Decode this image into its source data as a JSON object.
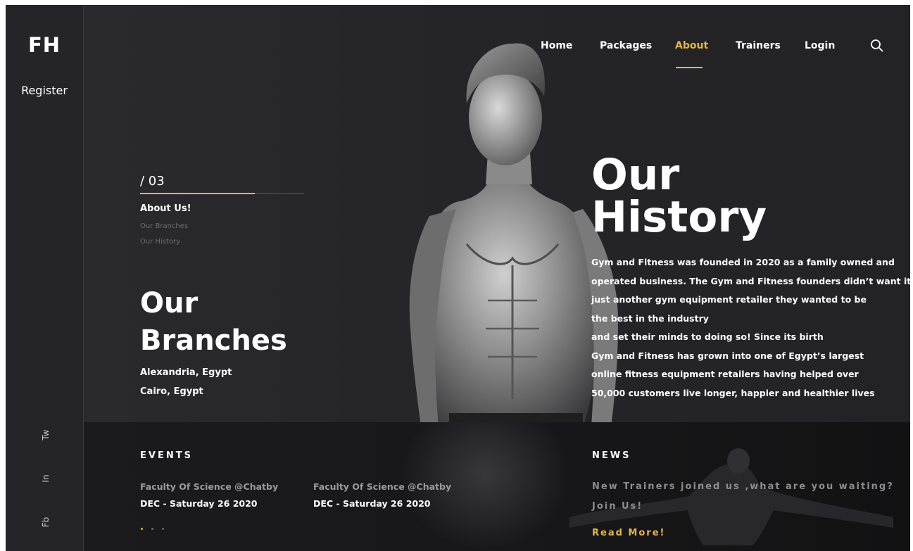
{
  "brand": {
    "logo": "FH",
    "register_label": "Register"
  },
  "social": [
    {
      "label": "Tw",
      "icon": "twitter"
    },
    {
      "label": "In",
      "icon": "linkedin"
    },
    {
      "label": "Fb",
      "icon": "facebook"
    }
  ],
  "nav": {
    "items": [
      "Home",
      "Packages",
      "About",
      "Trainers",
      "Login"
    ],
    "active": "About",
    "search_icon": "search-icon"
  },
  "left": {
    "counter": "/ 03",
    "progress": 0.7,
    "about_title": "About Us!",
    "sub_links": [
      "Our Branches",
      "Our History"
    ],
    "branches_title": "Our\nBranches",
    "branches": [
      "Alexandria, Egypt",
      "Cairo, Egypt"
    ]
  },
  "history": {
    "title": "Our\nHistory",
    "lines": [
      "Gym and Fitness was founded in 2020 as a family owned and",
      "operated business. The Gym and Fitness founders didn’t want it to be",
      "just another gym equipment retailer they wanted to be",
      "the best in the industry",
      "and set their minds to doing so! Since its birth",
      "Gym and Fitness has grown into one of Egypt’s largest",
      "online fitness equipment retailers having helped over",
      "50,000 customers live longer, happier and healthier lives"
    ]
  },
  "events": {
    "heading": "EVENTS",
    "items": [
      {
        "place": "Faculty Of Science @Chatby",
        "date": "DEC - Saturday 26 2020"
      },
      {
        "place": "Faculty Of Science @Chatby",
        "date": "DEC - Saturday 26 2020"
      }
    ],
    "pager_count": 3,
    "pager_active": 0
  },
  "news": {
    "heading": "NEWS",
    "text": "New Trainers joined us ,what are you waiting? Join Us!",
    "read_more": "Read More!"
  },
  "colors": {
    "accent": "#e4b54d",
    "background": "#26262a",
    "footer": "#171719"
  }
}
